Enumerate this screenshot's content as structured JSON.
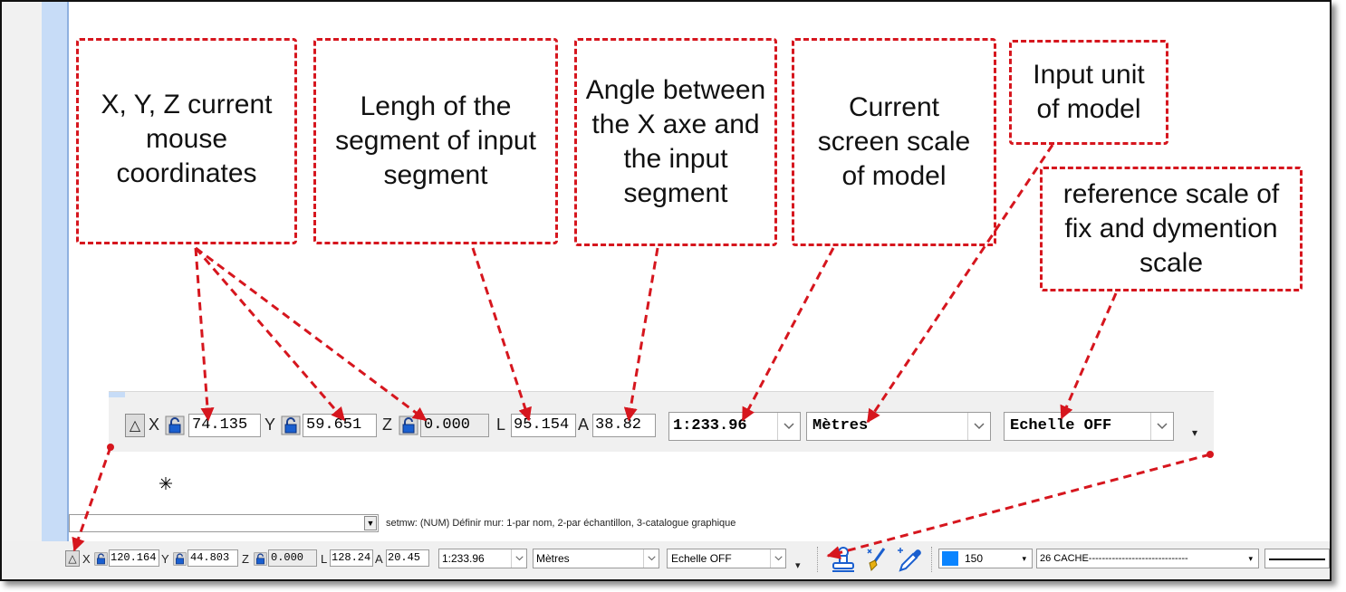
{
  "callouts": {
    "coords": "X, Y, Z current mouse coordinates",
    "length": "Lengh of the segment of input segment",
    "angle": "Angle between the X axe and the input segment",
    "screen_scale": "Current screen scale of model",
    "input_unit": "Input unit of model",
    "reference_scale": "reference scale of fix and dymention scale"
  },
  "float_toolbar": {
    "delta": "△",
    "x_label": "X",
    "x_value": "74.135",
    "y_label": "Y",
    "y_value": "59.651",
    "z_label": "Z",
    "z_value": "0.000",
    "l_label": "L",
    "l_value": "95.154",
    "a_label": "A",
    "a_value": "38.82",
    "scale": "1:233.96",
    "unit": "Mètres",
    "echelle": "Echelle OFF",
    "overflow": "▾"
  },
  "command": {
    "dropdown_arrow": "▼",
    "status": "setmw:  (NUM)  Définir mur: 1-par nom, 2-par échantillon, 3-catalogue graphique"
  },
  "bottom_toolbar": {
    "delta": "△",
    "x_label": "X",
    "x_value": "120.164",
    "y_label": "Y",
    "y_value": "44.803",
    "z_label": "Z",
    "z_value": "0.000",
    "l_label": "L",
    "l_value": "128.24",
    "a_label": "A",
    "a_value": "20.45",
    "scale": "1:233.96",
    "unit": "Mètres",
    "echelle": "Echelle OFF",
    "overflow": "▾",
    "color_value": "150",
    "layer_value": "26 CACHE------------------------------"
  },
  "colors": {
    "callout_border": "#d6161e",
    "arrow": "#d6161e",
    "toolbar_bg": "#f0f0f0",
    "color_swatch": "#0a84ff",
    "left_band": "#c7dcf7"
  },
  "icons": {
    "cursor": "crosshair-cursor-icon",
    "lock": "lock-icon",
    "stamp": "stamp-tool-icon",
    "brush": "paint-brush-icon",
    "eyedropper": "eyedropper-icon"
  }
}
